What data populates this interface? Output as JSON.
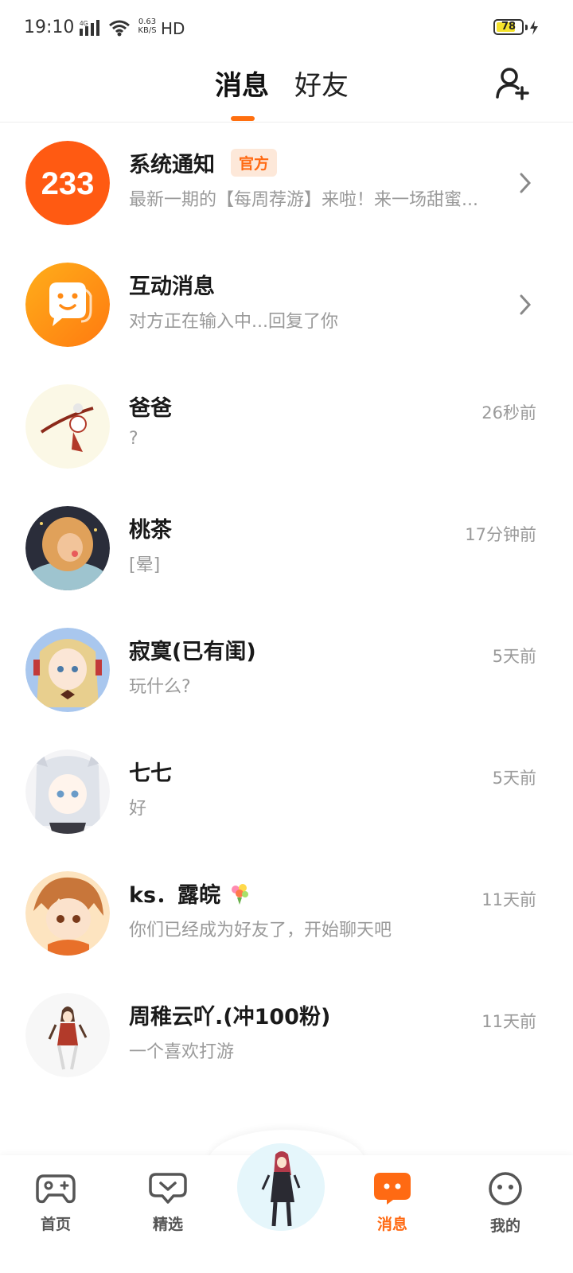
{
  "status_bar": {
    "time": "19:10",
    "network": "4G",
    "speed_value": "0.63",
    "speed_unit": "KB/S",
    "hd": "HD",
    "battery": "78",
    "battery_level": 0.78
  },
  "header": {
    "tabs": [
      {
        "label": "消息",
        "active": true
      },
      {
        "label": "好友",
        "active": false
      }
    ],
    "add_friend_icon": "add-user-icon",
    "accent": "#ff6f0f"
  },
  "conversations": [
    {
      "name": "系统通知",
      "badge": "官方",
      "message": "最新一期的【每周荐游】来啦！来一场甜蜜...",
      "time": "",
      "avatar": "233-logo"
    },
    {
      "name": "互动消息",
      "badge": "",
      "message": "对方正在输入中...回复了你",
      "time": "",
      "avatar": "chat-bubble-logo"
    },
    {
      "name": "爸爸",
      "message": "?",
      "time": "26秒前"
    },
    {
      "name": "桃茶",
      "message": "[晕]",
      "time": "17分钟前"
    },
    {
      "name": "寂寞(已有闺)",
      "message": "玩什么?",
      "time": "5天前"
    },
    {
      "name": "七七",
      "message": "好",
      "time": "5天前"
    },
    {
      "name": "ks．露皖",
      "message": "你们已经成为好友了，开始聊天吧",
      "time": "11天前"
    },
    {
      "name": "周稚云吖.(冲100粉)",
      "message": "一个喜欢打游",
      "time": "11天前"
    }
  ],
  "bottom_nav": {
    "items": [
      {
        "label": "首页",
        "icon": "gamepad-icon"
      },
      {
        "label": "精选",
        "icon": "heart-chat-icon"
      },
      {
        "label": "消息",
        "icon": "message-icon",
        "active": true
      },
      {
        "label": "我的",
        "icon": "profile-face-icon"
      }
    ]
  }
}
